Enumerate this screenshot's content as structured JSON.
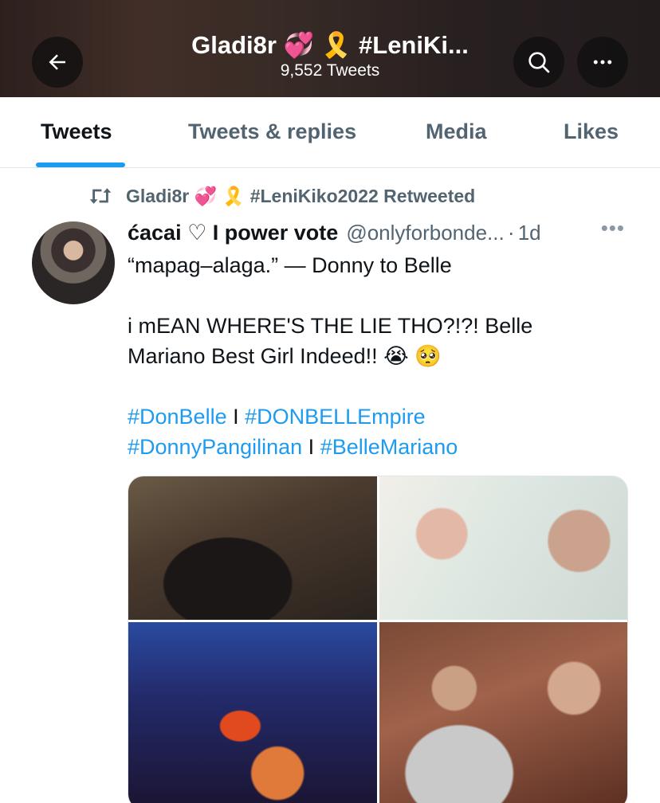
{
  "header": {
    "title": "Gladi8r 💞 🎗️ #LeniKi...",
    "subtitle": "9,552 Tweets"
  },
  "tabs": [
    {
      "label": "Tweets",
      "active": true
    },
    {
      "label": "Tweets & replies",
      "active": false
    },
    {
      "label": "Media",
      "active": false
    },
    {
      "label": "Likes",
      "active": false
    }
  ],
  "retweet": {
    "text": "Gladi8r 💞 🎗️ #LeniKiko2022 Retweeted"
  },
  "tweet": {
    "name": "ćacai ♡ I power vote",
    "handle": "@onlyforbonde...",
    "dot": "·",
    "time": "1d",
    "more": "•••",
    "line1": "“mapag–alaga.” — Donny to Belle",
    "line2": "i mEAN WHERE'S THE LIE THO?!?! Belle",
    "line3": "Mariano Best Girl Indeed!! 😭 🥺",
    "hashtags": {
      "h1": "#DonBelle",
      "sep1": " I ",
      "h2": "#DONBELLEmpire",
      "h3": "#DonnyPangilinan",
      "sep2": " I ",
      "h4": "#BelleMariano"
    }
  },
  "colors": {
    "accent": "#1d9bf0",
    "text": "#0f1419",
    "muted": "#536471"
  },
  "icons": {
    "back": "arrow-left-icon",
    "search": "search-icon",
    "more": "more-horizontal-icon",
    "retweet": "retweet-icon"
  }
}
